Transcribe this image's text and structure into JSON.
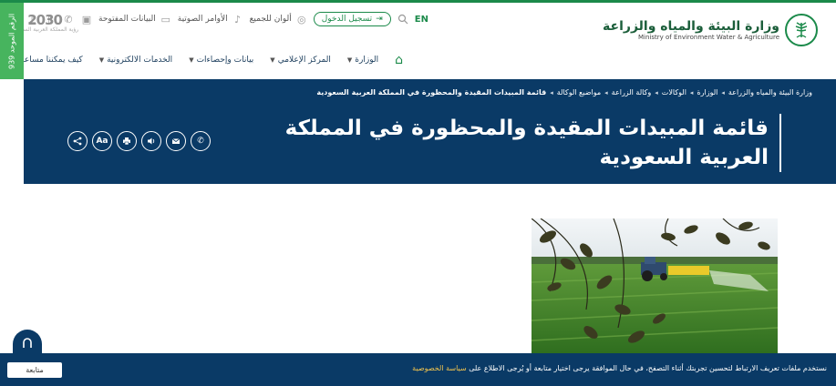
{
  "header": {
    "ministry_ar": "وزارة البيئة والمياه والزراعة",
    "ministry_en": "Ministry of Environment Water & Agriculture",
    "vision": "2030",
    "vision_sub": "رؤية المملكة العربية السعودية",
    "unified_number": "الرقم الموحد 939"
  },
  "utility": {
    "lang": "EN",
    "login": "تسجيل الدخول",
    "colors_for_all": "ألوان للجميع",
    "voice_commands": "الأوامر الصوتية",
    "open_data": "البيانات المفتوحة"
  },
  "nav": {
    "items": [
      "الوزارة",
      "المركز الإعلامي",
      "بيانات وإحصاءات",
      "الخدمات الالكترونية",
      "كيف يمكننا مساعدتك"
    ]
  },
  "breadcrumb": {
    "items": [
      "وزارة البيئة والمياه والزراعة",
      "الوزارة",
      "الوكالات",
      "وكالة الزراعة",
      "مواضيع الوكالة"
    ],
    "current": "قائمة المبيدات المقيدة والمحظورة في المملكة العربية السعودية"
  },
  "page": {
    "title": "قائمة المبيدات المقيدة والمحظورة في المملكة العربية السعودية"
  },
  "share_actions": [
    "share-icon",
    "font-size-icon",
    "print-icon",
    "audio-icon",
    "email-icon",
    "phone-icon"
  ],
  "cookie": {
    "text": "نستخدم ملفات تعريف الارتباط لتحسين تجربتك أثناء التصفح، في حال الموافقة يرجى اختيار متابعة أو يُرجى الاطلاع على",
    "link": "سياسة الخصوصية",
    "button": "متابعة"
  },
  "colors": {
    "brand_green": "#1b8a4a",
    "navy": "#0a3a66",
    "link_yellow": "#f0c34e"
  }
}
